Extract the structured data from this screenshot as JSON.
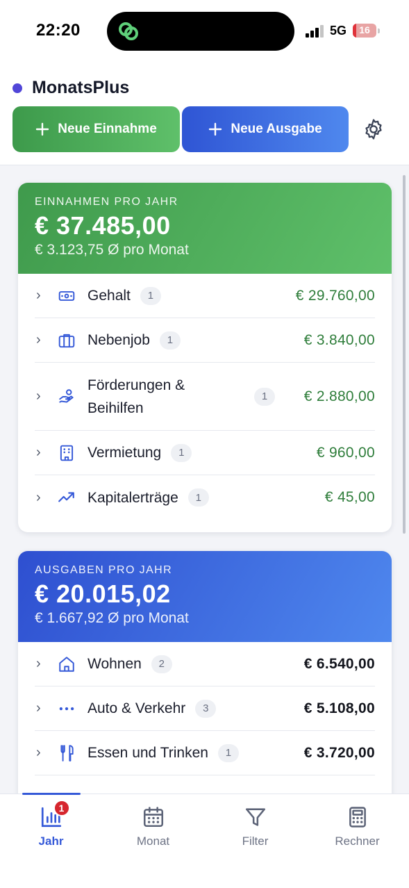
{
  "status_bar": {
    "time": "22:20",
    "network": "5G",
    "battery_level": "16",
    "battery_fraction": 0.16
  },
  "header": {
    "app_name": "MonatsPlus",
    "brand_color": "#5146d8",
    "income_button_label": "Neue Einnahme",
    "expense_button_label": "Neue Ausgabe",
    "settings_icon": "gear-icon"
  },
  "income_card": {
    "label": "EINNAHMEN PRO JAHR",
    "total": "€ 37.485,00",
    "monthly": "€ 3.123,75 Ø pro Monat",
    "color": "#4caf50",
    "items": [
      {
        "name": "Gehalt",
        "count": "1",
        "amount": "€ 29.760,00",
        "icon": "banknote-icon"
      },
      {
        "name": "Nebenjob",
        "count": "1",
        "amount": "€ 3.840,00",
        "icon": "briefcase-icon"
      },
      {
        "name": "Förderungen & Beihilfen",
        "count": "1",
        "amount": "€ 2.880,00",
        "icon": "hand-coin-icon"
      },
      {
        "name": "Vermietung",
        "count": "1",
        "amount": "€ 960,00",
        "icon": "building-icon"
      },
      {
        "name": "Kapitalerträge",
        "count": "1",
        "amount": "€ 45,00",
        "icon": "trending-up-icon"
      }
    ]
  },
  "expense_card": {
    "label": "AUSGABEN PRO JAHR",
    "total": "€ 20.015,02",
    "monthly": "€ 1.667,92 Ø pro Monat",
    "color": "#3b6be0",
    "items": [
      {
        "name": "Wohnen",
        "count": "2",
        "amount": "€ 6.540,00",
        "icon": "house-icon"
      },
      {
        "name": "Auto & Verkehr",
        "count": "3",
        "amount": "€ 5.108,00",
        "icon": "dots-icon"
      },
      {
        "name": "Essen und Trinken",
        "count": "1",
        "amount": "€ 3.720,00",
        "icon": "utensils-icon"
      }
    ]
  },
  "tabs": [
    {
      "label": "Jahr",
      "icon": "bar-chart-icon",
      "active": true,
      "badge": "1"
    },
    {
      "label": "Monat",
      "icon": "calendar-icon",
      "active": false
    },
    {
      "label": "Filter",
      "icon": "filter-icon",
      "active": false
    },
    {
      "label": "Rechner",
      "icon": "calculator-icon",
      "active": false
    }
  ]
}
